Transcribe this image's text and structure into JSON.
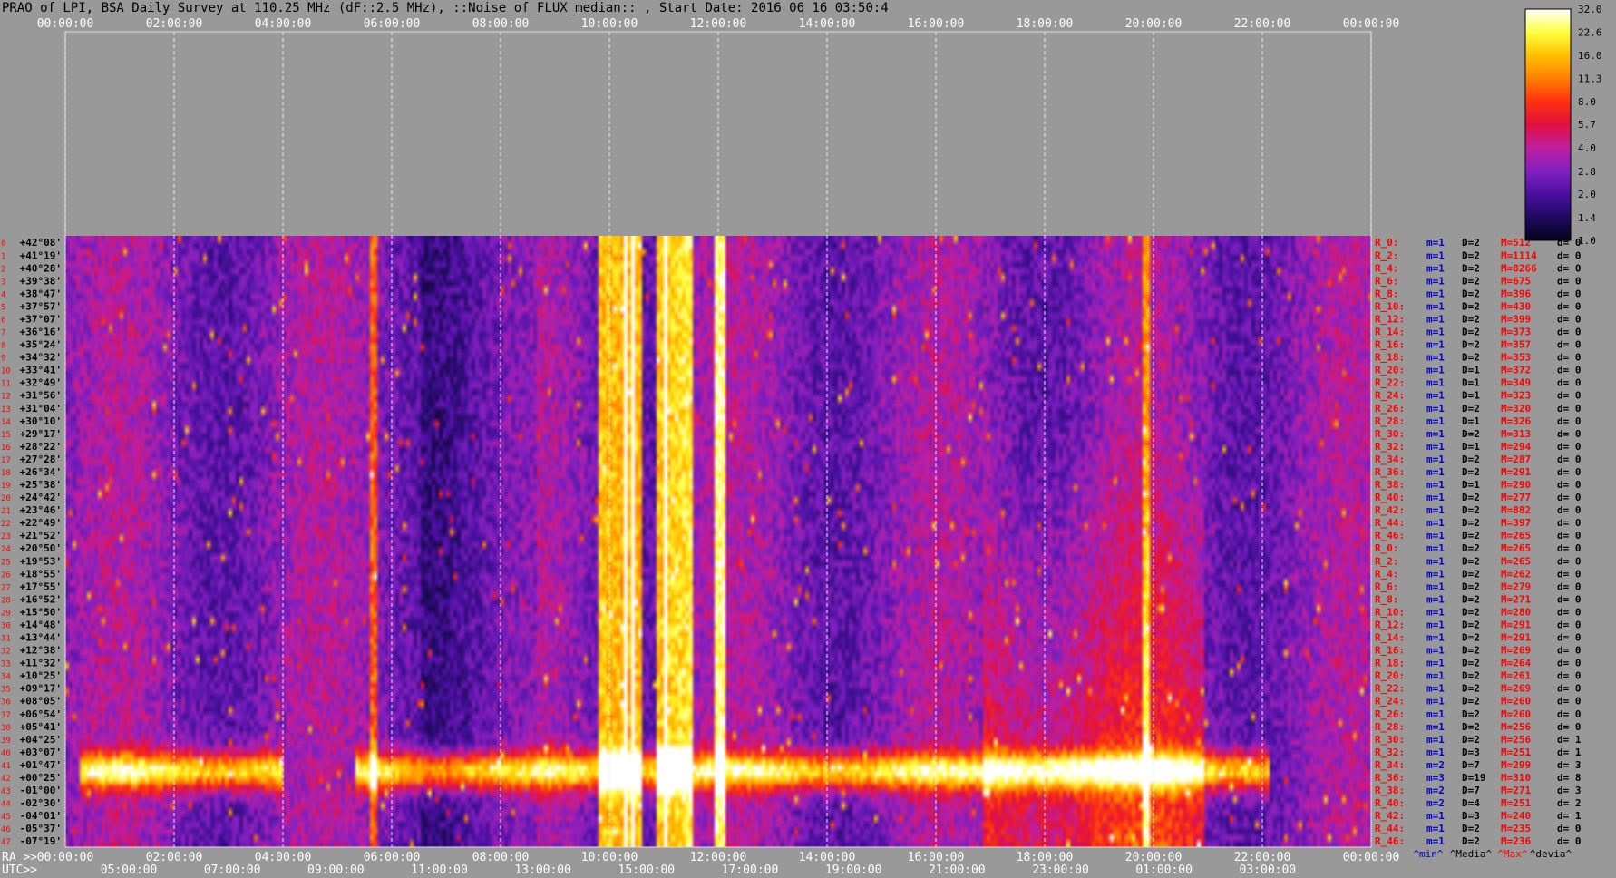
{
  "title": "PRAO of LPI, BSA Daily Survey at 110.25 MHz (dF::2.5 MHz), ::Noise_of_FLUX_median:: , Start Date: 2016 06 16 03:50:4",
  "chart_data": {
    "type": "heatmap",
    "top_time_ticks": [
      "00:00:00",
      "02:00:00",
      "04:00:00",
      "06:00:00",
      "08:00:00",
      "10:00:00",
      "12:00:00",
      "14:00:00",
      "16:00:00",
      "18:00:00",
      "20:00:00",
      "22:00:00",
      "00:00:00"
    ],
    "ra_axis_label": "RA >>",
    "ra_ticks": [
      "00:00:00",
      "02:00:00",
      "04:00:00",
      "06:00:00",
      "08:00:00",
      "10:00:00",
      "12:00:00",
      "14:00:00",
      "16:00:00",
      "18:00:00",
      "20:00:00",
      "22:00:00",
      "00:00:00"
    ],
    "utc_axis_label": "UTC>>",
    "utc_ticks": [
      "05:00:00",
      "07:00:00",
      "09:00:00",
      "11:00:00",
      "13:00:00",
      "15:00:00",
      "17:00:00",
      "19:00:00",
      "21:00:00",
      "23:00:00",
      "01:00:00",
      "03:00:00"
    ],
    "declinations": [
      "+42°08'",
      "+41°19'",
      "+40°28'",
      "+39°38'",
      "+38°47'",
      "+37°57'",
      "+37°07'",
      "+36°16'",
      "+35°24'",
      "+34°32'",
      "+33°41'",
      "+32°49'",
      "+31°56'",
      "+31°04'",
      "+30°10'",
      "+29°17'",
      "+28°22'",
      "+27°28'",
      "+26°34'",
      "+25°38'",
      "+24°42'",
      "+23°46'",
      "+22°49'",
      "+21°52'",
      "+20°50'",
      "+19°53'",
      "+18°55'",
      "+17°55'",
      "+16°52'",
      "+15°50'",
      "+14°48'",
      "+13°44'",
      "+12°38'",
      "+11°32'",
      "+10°25'",
      "+09°17'",
      "+08°05'",
      "+06°54'",
      "+05°41'",
      "+04°25'",
      "+03°07'",
      "+01°47'",
      "+00°25'",
      "-01°00'",
      "-02°30'",
      "-04°01'",
      "-05°37'",
      "-07°19'"
    ],
    "row_stats": [
      [
        "R_0:",
        "m=1",
        "D=2",
        "M=512",
        "d= 0"
      ],
      [
        "R_2:",
        "m=1",
        "D=2",
        "M=1114",
        "d= 0"
      ],
      [
        "R_4:",
        "m=1",
        "D=2",
        "M=8266",
        "d= 0"
      ],
      [
        "R_6:",
        "m=1",
        "D=2",
        "M=675",
        "d= 0"
      ],
      [
        "R_8:",
        "m=1",
        "D=2",
        "M=396",
        "d= 0"
      ],
      [
        "R_10:",
        "m=1",
        "D=2",
        "M=430",
        "d= 0"
      ],
      [
        "R_12:",
        "m=1",
        "D=2",
        "M=399",
        "d= 0"
      ],
      [
        "R_14:",
        "m=1",
        "D=2",
        "M=373",
        "d= 0"
      ],
      [
        "R_16:",
        "m=1",
        "D=2",
        "M=357",
        "d= 0"
      ],
      [
        "R_18:",
        "m=1",
        "D=2",
        "M=353",
        "d= 0"
      ],
      [
        "R_20:",
        "m=1",
        "D=1",
        "M=372",
        "d= 0"
      ],
      [
        "R_22:",
        "m=1",
        "D=1",
        "M=349",
        "d= 0"
      ],
      [
        "R_24:",
        "m=1",
        "D=1",
        "M=323",
        "d= 0"
      ],
      [
        "R_26:",
        "m=1",
        "D=2",
        "M=320",
        "d= 0"
      ],
      [
        "R_28:",
        "m=1",
        "D=1",
        "M=326",
        "d= 0"
      ],
      [
        "R_30:",
        "m=1",
        "D=2",
        "M=313",
        "d= 0"
      ],
      [
        "R_32:",
        "m=1",
        "D=1",
        "M=294",
        "d= 0"
      ],
      [
        "R_34:",
        "m=1",
        "D=2",
        "M=287",
        "d= 0"
      ],
      [
        "R_36:",
        "m=1",
        "D=2",
        "M=291",
        "d= 0"
      ],
      [
        "R_38:",
        "m=1",
        "D=1",
        "M=290",
        "d= 0"
      ],
      [
        "R_40:",
        "m=1",
        "D=2",
        "M=277",
        "d= 0"
      ],
      [
        "R_42:",
        "m=1",
        "D=2",
        "M=882",
        "d= 0"
      ],
      [
        "R_44:",
        "m=1",
        "D=2",
        "M=397",
        "d= 0"
      ],
      [
        "R_46:",
        "m=1",
        "D=2",
        "M=265",
        "d= 0"
      ],
      [
        "R_0:",
        "m=1",
        "D=2",
        "M=265",
        "d= 0"
      ],
      [
        "R_2:",
        "m=1",
        "D=2",
        "M=265",
        "d= 0"
      ],
      [
        "R_4:",
        "m=1",
        "D=2",
        "M=262",
        "d= 0"
      ],
      [
        "R_6:",
        "m=1",
        "D=2",
        "M=279",
        "d= 0"
      ],
      [
        "R_8:",
        "m=1",
        "D=2",
        "M=271",
        "d= 0"
      ],
      [
        "R_10:",
        "m=1",
        "D=2",
        "M=280",
        "d= 0"
      ],
      [
        "R_12:",
        "m=1",
        "D=2",
        "M=291",
        "d= 0"
      ],
      [
        "R_14:",
        "m=1",
        "D=2",
        "M=291",
        "d= 0"
      ],
      [
        "R_16:",
        "m=1",
        "D=2",
        "M=269",
        "d= 0"
      ],
      [
        "R_18:",
        "m=1",
        "D=2",
        "M=264",
        "d= 0"
      ],
      [
        "R_20:",
        "m=1",
        "D=2",
        "M=261",
        "d= 0"
      ],
      [
        "R_22:",
        "m=1",
        "D=2",
        "M=269",
        "d= 0"
      ],
      [
        "R_24:",
        "m=1",
        "D=2",
        "M=260",
        "d= 0"
      ],
      [
        "R_26:",
        "m=1",
        "D=2",
        "M=260",
        "d= 0"
      ],
      [
        "R_28:",
        "m=1",
        "D=2",
        "M=256",
        "d= 0"
      ],
      [
        "R_30:",
        "m=1",
        "D=2",
        "M=256",
        "d= 1"
      ],
      [
        "R_32:",
        "m=1",
        "D=3",
        "M=251",
        "d= 1"
      ],
      [
        "R_34:",
        "m=2",
        "D=7",
        "M=299",
        "d= 3"
      ],
      [
        "R_36:",
        "m=3",
        "D=19",
        "M=310",
        "d= 8"
      ],
      [
        "R_38:",
        "m=2",
        "D=7",
        "M=271",
        "d= 3"
      ],
      [
        "R_40:",
        "m=2",
        "D=4",
        "M=251",
        "d= 2"
      ],
      [
        "R_42:",
        "m=1",
        "D=3",
        "M=240",
        "d= 1"
      ],
      [
        "R_44:",
        "m=1",
        "D=2",
        "M=235",
        "d= 0"
      ],
      [
        "R_46:",
        "m=1",
        "D=2",
        "M=236",
        "d= 0"
      ]
    ],
    "stats_footer": [
      "^min^",
      "^Media^",
      "^Max^",
      "^devia^"
    ],
    "colorbar_ticks": [
      "32.0",
      "22.6",
      "16.0",
      "11.3",
      "8.0",
      "5.7",
      "4.0",
      "2.8",
      "2.0",
      "1.4",
      "1.0"
    ],
    "colorbar_range": [
      1.0,
      32.0
    ],
    "colorbar_scale": "log",
    "colormap_stops": [
      "#05021a",
      "#200a60",
      "#4a10a0",
      "#8020c0",
      "#c020a0",
      "#e01040",
      "#ff3010",
      "#ff8000",
      "#ffc000",
      "#ffff40",
      "#ffffff"
    ],
    "palette": {
      "stat_label": "#ff0000",
      "stat_min": "#0000cc",
      "stat_D": "#000000",
      "stat_max": "#ff0000",
      "stat_dev": "#000000",
      "axis_text": "#ffffff",
      "dec_text": "#000000",
      "row_index": "#ff0000"
    }
  }
}
